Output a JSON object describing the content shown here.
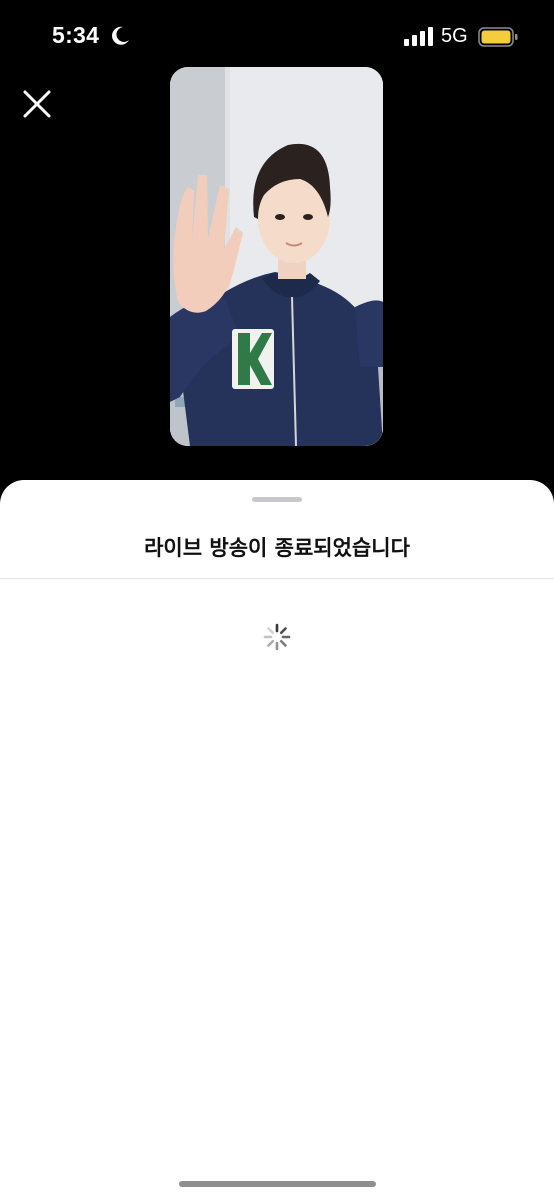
{
  "status_bar": {
    "time": "5:34",
    "network": "5G",
    "icons": [
      "moon-icon",
      "signal-icon",
      "battery-icon"
    ],
    "battery_color": "#f5cd3c"
  },
  "header": {
    "close_icon": "close-icon"
  },
  "sheet": {
    "title": "라이브 방송이 종료되었습니다",
    "loading_icon": "spinner-icon"
  },
  "colors": {
    "background": "#000000",
    "sheet_background": "#ffffff",
    "title_text": "#111111",
    "jacket": "#25325a",
    "patch": "#2f7a47"
  }
}
